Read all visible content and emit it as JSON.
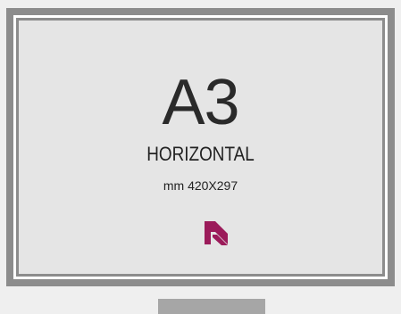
{
  "sheet": {
    "format": "A3",
    "orientation": "HORIZONTAL",
    "dimensions": "mm 420X297"
  },
  "colors": {
    "frame_gray": "#8c8c8c",
    "panel_bg": "#e5e5e5",
    "logo_accent": "#9b1b5a",
    "bottom_tab": "#a6a6a6"
  },
  "icons": {
    "logo": "brand-logo-icon"
  }
}
